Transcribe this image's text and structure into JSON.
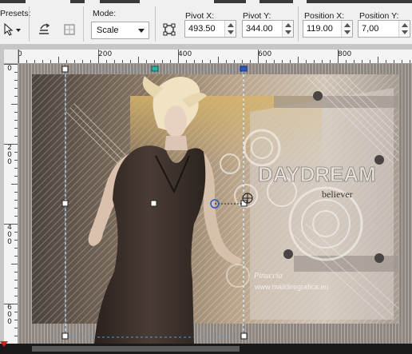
{
  "toolbar": {
    "presets_label": "Presets:",
    "mode_label": "Mode:",
    "mode_value": "Scale",
    "pivot_x_label": "Pivot X:",
    "pivot_x_value": "493.50",
    "pivot_y_label": "Pivot Y:",
    "pivot_y_value": "344.00",
    "position_x_label": "Position X:",
    "position_x_value": "119.00",
    "position_y_label": "Position Y:",
    "position_y_value": "7,00"
  },
  "ruler": {
    "h_labels": [
      "0",
      "200",
      "400",
      "600",
      "800"
    ],
    "v_labels": [
      "0",
      "2\n0\n0",
      "4\n0\n0",
      "6\n0\n0"
    ]
  },
  "canvas": {
    "title_text": "DAYDREAM",
    "subtitle_text": "believer",
    "watermark_line1": "Pinuccia",
    "watermark_line2": "www.maildiregrafica.eu"
  },
  "colors": {
    "bg_dark": "#5f5650",
    "bg_warm": "#b7a690",
    "frame": "#8a8580",
    "handle_teal": "#27b4a8",
    "handle_blue": "#2b57c9"
  },
  "icons": {
    "pick_tool": "arrow-cursor-icon",
    "preset": "presets-dropdown-icon",
    "flip": "flip-icon",
    "grid": "grid-icon",
    "transform": "transform-icon"
  }
}
